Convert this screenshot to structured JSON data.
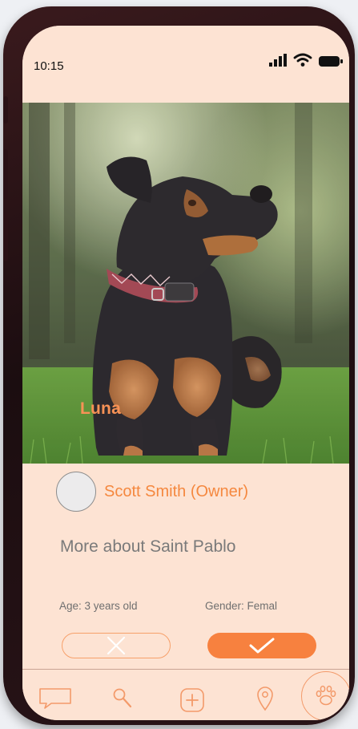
{
  "status_bar": {
    "time": "10:15",
    "icons": [
      "signal-icon",
      "wifi-icon",
      "battery-icon"
    ]
  },
  "profile": {
    "pet_name": "Luna",
    "owner_name": "Scott Smith (Owner)",
    "more_about": "More about Saint Pablo",
    "age": "Age: 3 years old",
    "gender": "Gender: Femal"
  },
  "actions": {
    "reject_icon": "close-icon",
    "accept_icon": "check-icon"
  },
  "nav": {
    "items": [
      "chat-icon",
      "search-icon",
      "add-icon",
      "location-icon",
      "paw-icon"
    ],
    "active": "paw-icon"
  },
  "colors": {
    "accent": "#f7813f",
    "background": "#fde3d3",
    "text_muted": "#7a7a7a"
  }
}
